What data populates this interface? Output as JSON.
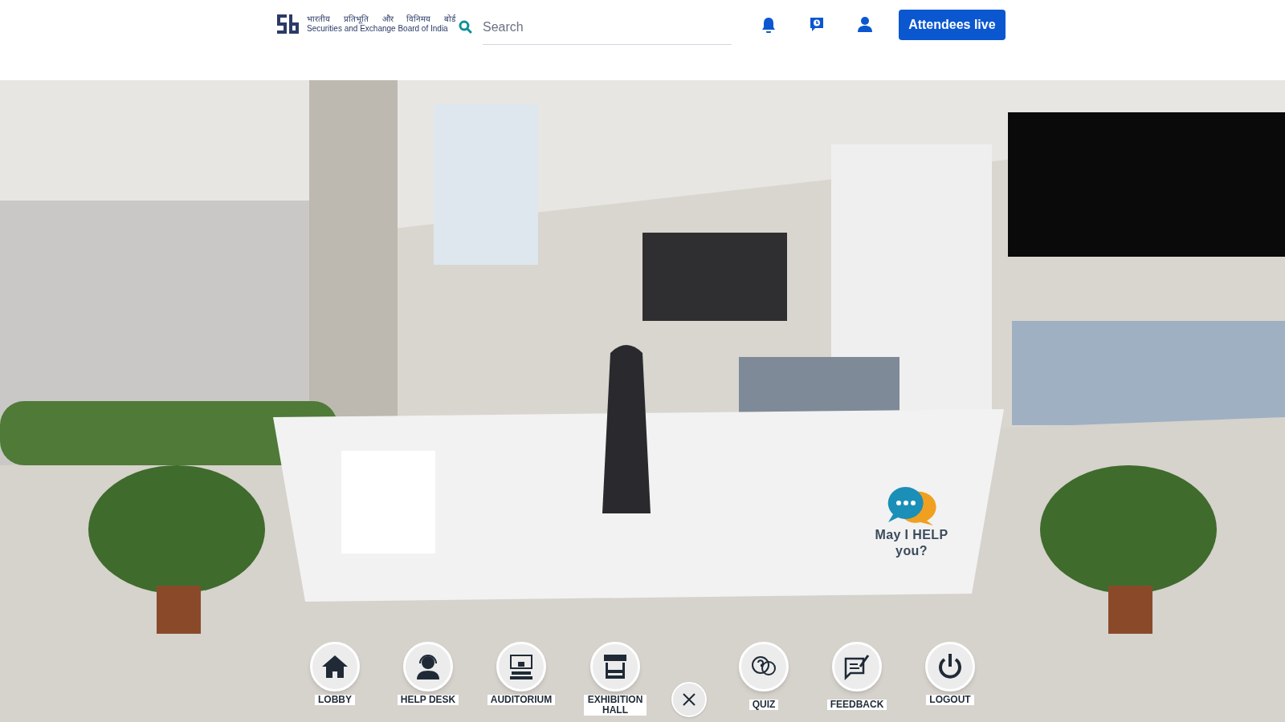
{
  "header": {
    "logo": {
      "hindi": "भारतीय प्रतिभूति और विनिमय बोर्ड",
      "english": "Securities and Exchange Board of India"
    },
    "search": {
      "placeholder": "Search"
    },
    "icons": [
      {
        "kind": "bell"
      },
      {
        "kind": "chat-clock"
      },
      {
        "kind": "user"
      }
    ],
    "button": "Attendees live"
  },
  "scene": {
    "help_bubble": "May I HELP you?"
  },
  "nav": [
    {
      "kind": "home",
      "label": "LOBBY"
    },
    {
      "kind": "headset",
      "label": "HELP DESK"
    },
    {
      "kind": "stage",
      "label": "AUDITORIUM"
    },
    {
      "kind": "stall",
      "label": "EXHIBITION HALL"
    },
    {
      "kind": "close"
    },
    {
      "kind": "quiz",
      "label": "QUIZ"
    },
    {
      "kind": "feedback",
      "label": "FEEDBACK"
    },
    {
      "kind": "power",
      "label": "LOGOUT"
    }
  ]
}
